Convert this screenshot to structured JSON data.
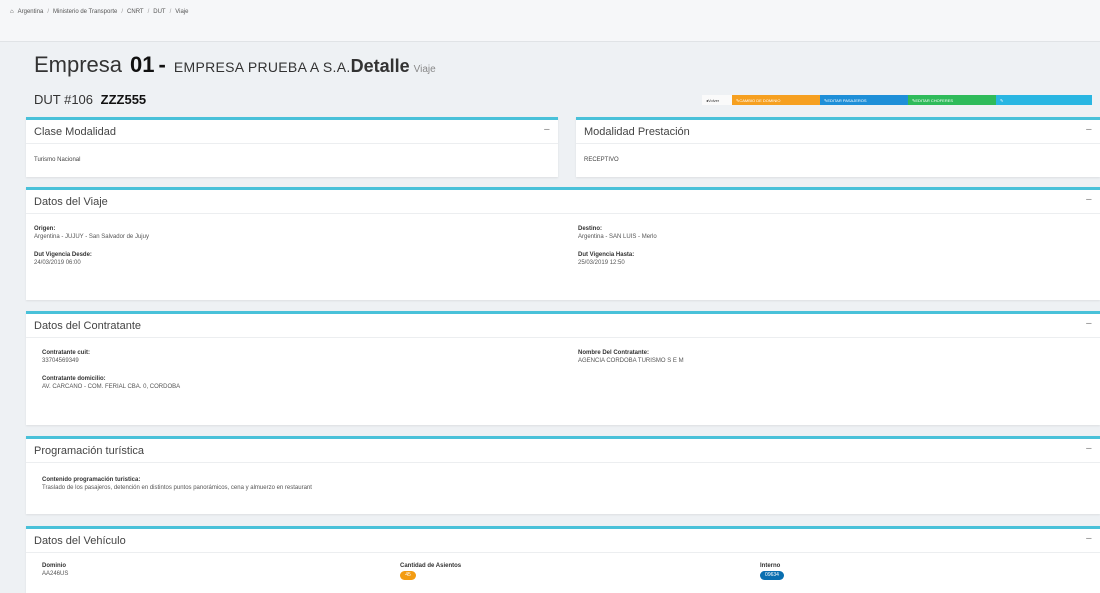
{
  "breadcrumb": {
    "items": [
      "Argentina",
      "Ministerio de Transporte",
      "CNRT",
      "DUT",
      "Viaje"
    ],
    "separator": "/"
  },
  "header": {
    "label": "Empresa",
    "number": "01",
    "dash": "-",
    "company": "EMPRESA PRUEBA A S.A.",
    "detail": "Detalle",
    "sub": "Viaje"
  },
  "dut": {
    "label": "DUT #106",
    "plate": "ZZZ555"
  },
  "actions": {
    "volver": "Volver",
    "cambio": "CAMBIO DE DOMINIO",
    "pasajeros": "EDITAR PASAJEROS",
    "choferes": "EDITAR CHOFERES",
    "extra": ""
  },
  "clase_modalidad": {
    "title": "Clase Modalidad",
    "value": "Turismo Nacional"
  },
  "modalidad_prestacion": {
    "title": "Modalidad Prestación",
    "value": "RECEPTIVO"
  },
  "datos_viaje": {
    "title": "Datos del Viaje",
    "origen_label": "Origen:",
    "origen_value": "Argentina - JUJUY - San Salvador de Jujuy",
    "destino_label": "Destino:",
    "destino_value": "Argentina - SAN LUIS - Merlo",
    "desde_label": "Dut Vigencia Desde:",
    "desde_value": "24/03/2019 06:00",
    "hasta_label": "Dut Vigencia Hasta:",
    "hasta_value": "25/03/2019 12:50"
  },
  "contratante": {
    "title": "Datos del Contratante",
    "cuit_label": "Contratante cuit:",
    "cuit_value": "33704569349",
    "nombre_label": "Nombre Del Contratante:",
    "nombre_value": "AGENCIA CORDOBA TURISMO S E M",
    "domicilio_label": "Contratante domicilio:",
    "domicilio_value": "AV. CARCANO - COM. FERIAL CBA. 0, CORDOBA"
  },
  "programacion": {
    "title": "Programación turística",
    "contenido_label": "Contenido programación turistica:",
    "contenido_value": "Traslado de los pasajeros, detención en distintos puntos panorámicos, cena y almuerzo en restaurant"
  },
  "vehiculo": {
    "title": "Datos del Vehículo",
    "dominio_label": "Dominio",
    "dominio_value": "AA246US",
    "asientos_label": "Cantidad de Asientos",
    "asientos_value": "45",
    "interno_label": "Interno",
    "interno_value": "09634"
  },
  "colors": {
    "accent": "#49c1d9",
    "orange": "#f6a020",
    "blue": "#1e8fd8",
    "green": "#2fbb5a"
  }
}
